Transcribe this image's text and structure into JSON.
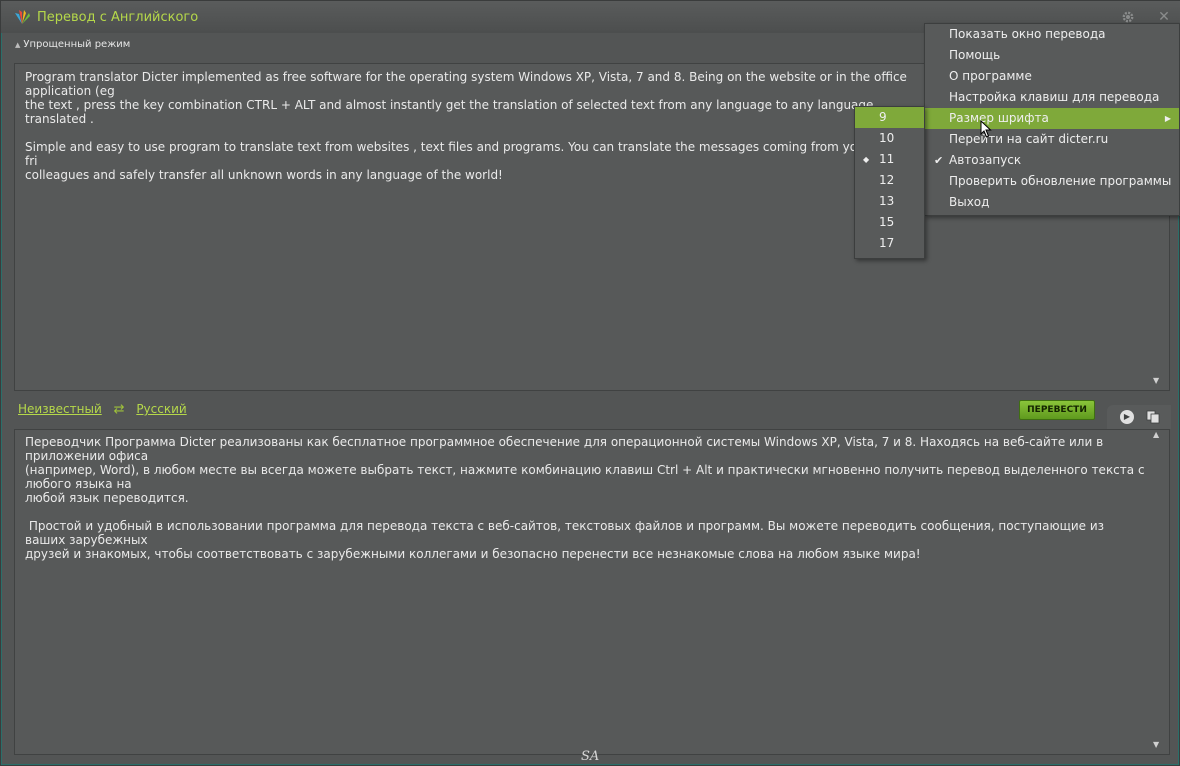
{
  "window": {
    "title": "Перевод с Английского",
    "settings_icon": "gear-icon",
    "close_label": "✕"
  },
  "mode": {
    "label": "Упрощенный режим"
  },
  "source": {
    "text": "Program translator Dicter implemented as free software for the operating system Windows XP, Vista, 7 and 8. Being on the website or in the office application (eg\nthe text , press the key combination CTRL + ALT and almost instantly get the translation of selected text from any language to any language translated .\n\nSimple and easy to use program to translate text from websites , text files and programs. You can translate the messages coming from your foreign fri\ncolleagues and safely transfer all unknown words in any language of the world!"
  },
  "languages": {
    "from": "Неизвестный",
    "swap_icon": "⇄",
    "to": "Русский"
  },
  "translate_button": "ПЕРЕВЕСТИ",
  "target": {
    "text": "Переводчик Программа Dicter реализованы как бесплатное программное обеспечение для операционной системы Windows XP, Vista, 7 и 8. Находясь на веб-сайте или в приложении офиса\n(например, Word), в любом месте вы всегда можете выбрать текст, нажмите комбинацию клавиш Ctrl + Alt и практически мгновенно получить перевод выделенного текста с любого языка на\nлюбой язык переводится.\n\n Простой и удобный в использовании программа для перевода текста с веб-сайтов, текстовых файлов и программ. Вы можете переводить сообщения, поступающие из ваших зарубежных\nдрузей и знакомых, чтобы соответствовать с зарубежными коллегами и безопасно перенести все незнакомые слова на любом языке мира!"
  },
  "signature": "SA",
  "context_menu": {
    "items": [
      {
        "label": "Показать окно перевода"
      },
      {
        "label": "Помощь"
      },
      {
        "label": "О программе"
      },
      {
        "label": "Настройка клавиш для перевода"
      },
      {
        "label": "Размер шрифта"
      },
      {
        "label": "Перейти на сайт dicter.ru"
      },
      {
        "label": "Автозапуск"
      },
      {
        "label": "Проверить обновление программы"
      },
      {
        "label": "Выход"
      }
    ],
    "checked_mark": "✔",
    "submenu_arrow": "▶"
  },
  "font_size_menu": {
    "items": [
      {
        "label": "9"
      },
      {
        "label": "10"
      },
      {
        "label": "11"
      },
      {
        "label": "12"
      },
      {
        "label": "13"
      },
      {
        "label": "15"
      },
      {
        "label": "17"
      }
    ],
    "selected_mark": "◆"
  },
  "colors": {
    "accent": "#b5d84a",
    "highlight": "#7fa93a",
    "background": "#535555"
  }
}
